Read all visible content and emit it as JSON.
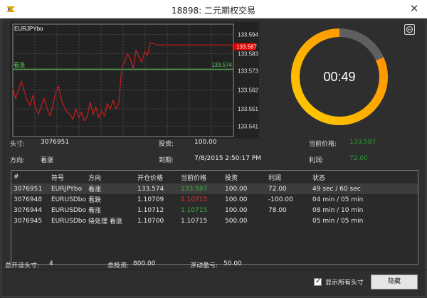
{
  "window": {
    "title": "18898: 二元期权交易",
    "close_symbol": "✕"
  },
  "chart_data": {
    "type": "line",
    "title": "EURJPYbo",
    "series": [
      {
        "values": [
          133.563,
          133.557,
          133.562,
          133.567,
          133.561,
          133.556,
          133.553,
          133.559,
          133.551,
          133.548,
          133.553,
          133.557,
          133.551,
          133.547,
          133.553,
          133.561,
          133.564,
          133.556,
          133.552,
          133.549,
          133.548,
          133.545,
          133.551,
          133.546,
          133.549,
          133.544,
          133.547,
          133.555,
          133.548,
          133.552,
          133.546,
          133.55,
          133.547,
          133.554,
          133.551,
          133.556,
          133.551,
          133.554,
          133.575,
          133.578,
          133.583,
          133.58,
          133.574,
          133.585,
          133.581,
          133.578,
          133.584,
          133.582,
          133.589,
          133.589,
          133.588,
          133.588,
          133.588,
          133.588,
          133.588,
          133.588,
          133.588,
          133.588,
          133.588,
          133.588,
          133.588,
          133.588,
          133.588,
          133.588,
          133.588,
          133.588,
          133.588,
          133.588,
          133.588,
          133.588,
          133.588,
          133.588,
          133.588,
          133.588,
          133.588,
          133.588,
          133.588,
          133.587
        ]
      }
    ],
    "y_ticks": [
      "133.594",
      "133.583",
      "133.573",
      "133.562",
      "133.551",
      "133.541"
    ],
    "ylim": [
      133.535,
      133.6
    ],
    "reference_line": {
      "label": "看涨",
      "value": 133.574,
      "value_label": "133.574",
      "color": "#5fcf5f"
    },
    "current_price": {
      "value": 133.587,
      "label": "133.587",
      "color": "#e00000"
    },
    "grid": true,
    "line_color": "#c81e1e"
  },
  "timer": {
    "text": "00:49",
    "elapsed_fraction": 0.1833,
    "colors": {
      "remaining": "#5f5f5f",
      "elapsed_start": "#ffcc00",
      "elapsed_end": "#ff8a00"
    },
    "back_icon": "back-arrow-icon"
  },
  "info": {
    "position_label": "头寸:",
    "position_value": "3076951",
    "direction_label": "方向:",
    "direction_value": "看涨",
    "investment_label": "投资:",
    "investment_value": "100.00",
    "expiry_label": "到期:",
    "expiry_value": "7/8/2015 2:50:17 PM",
    "current_price_label": "当前价格:",
    "current_price_value": "133.587",
    "profit_label": "利润:",
    "profit_value": "72.00"
  },
  "grid": {
    "headers": [
      "#",
      "符号",
      "方向",
      "开仓价格",
      "当前价格",
      "投资",
      "利润",
      "状态"
    ],
    "rows": [
      {
        "id": "3076951",
        "symbol": "EURJPYbo",
        "direction": "看涨",
        "open_price": "133.574",
        "current_price": "133.587",
        "price_trend": "pos",
        "investment": "100.00",
        "profit": "72.00",
        "status": "49 sec / 60 sec",
        "selected": true
      },
      {
        "id": "3076948",
        "symbol": "EURUSDbo",
        "direction": "看跌",
        "open_price": "1.10709",
        "current_price": "1.10715",
        "price_trend": "neg",
        "investment": "100.00",
        "profit": "-100.00",
        "status": "04 min / 05 min",
        "selected": false
      },
      {
        "id": "3076944",
        "symbol": "EURUSDbo",
        "direction": "看涨",
        "open_price": "1.10712",
        "current_price": "1.10715",
        "price_trend": "pos",
        "investment": "100.00",
        "profit": "78.00",
        "status": "08 min / 10 min",
        "selected": false
      },
      {
        "id": "3076945",
        "symbol": "EURUSDbo",
        "direction": "待处理 看涨",
        "open_price": "1.10700",
        "current_price": "1.10715",
        "price_trend": "none",
        "investment": "500.00",
        "profit": "",
        "status": "05 min / 05 min",
        "selected": false
      }
    ]
  },
  "totals": {
    "open_positions_label": "总开设头寸:",
    "open_positions_value": "4",
    "total_investment_label": "总投资:",
    "total_investment_value": "800.00",
    "floating_pl_label": "浮动盈亏:",
    "floating_pl_value": "50.00"
  },
  "controls": {
    "show_all_label": "显示所有头寸",
    "show_all_checked": true,
    "hide_button_label": "隐藏"
  }
}
